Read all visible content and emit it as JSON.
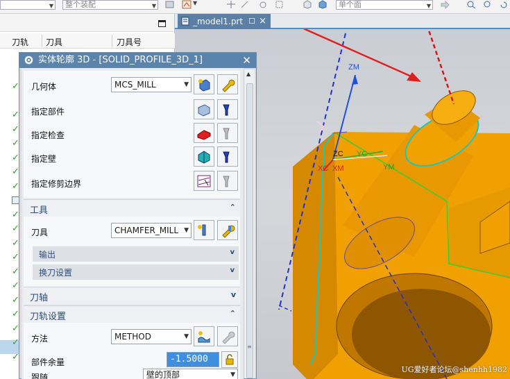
{
  "top_toolbar": {
    "combo_left": "",
    "combo_assembly": "整个装配",
    "combo_body": "单个面"
  },
  "navigator": {
    "columns": [
      "刀轨",
      "刀具",
      "刀具号"
    ]
  },
  "viewport": {
    "tab_label": "_model1.prt",
    "axis_labels": {
      "zm": "ZM",
      "zc": "ZC",
      "yc": "YC",
      "ym": "YM",
      "xc": "XC",
      "xm": "XM"
    },
    "watermark": "UG爱好者论坛@shenhh1982"
  },
  "dialog": {
    "title": "实体轮廓 3D - [SOLID_PROFILE_3D_1]",
    "geometry": {
      "label": "几何体",
      "value": "MCS_MILL",
      "rows": [
        "指定部件",
        "指定检查",
        "指定壁",
        "指定修剪边界"
      ]
    },
    "tool_section": {
      "header": "工具",
      "tool_label": "刀具",
      "tool_value": "CHAMFER_MILL",
      "sub_output": "输出",
      "sub_toolchange": "换刀设置"
    },
    "axis_section": {
      "header": "刀轴"
    },
    "path_section": {
      "header": "刀轨设置",
      "method_label": "方法",
      "method_value": "METHOD",
      "stock_label": "部件余量",
      "stock_value": "-1.5000",
      "follow_label": "跟随",
      "follow_value": "壁的顶部"
    }
  },
  "colors": {
    "dialog_title_bg": "#5b84ad",
    "part_orange": "#f0a000",
    "accent_blue": "#2a4d7a"
  }
}
